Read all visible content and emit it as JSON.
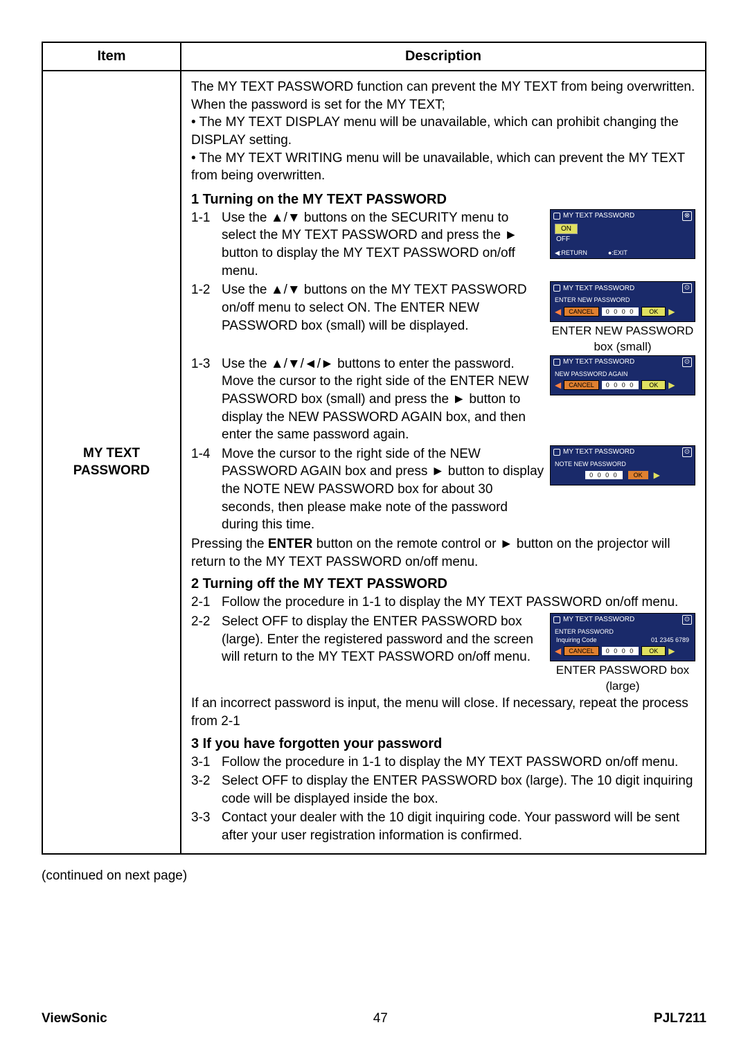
{
  "table": {
    "header_item": "Item",
    "header_desc": "Description",
    "item_name_line1": "MY TEXT",
    "item_name_line2": "PASSWORD"
  },
  "intro": {
    "p1": "The MY TEXT PASSWORD function can prevent the MY TEXT from being overwritten. When the password is set for the MY TEXT;",
    "b1": "• The MY TEXT DISPLAY menu will be unavailable, which can prohibit changing the DISPLAY setting.",
    "b2": "• The MY TEXT WRITING menu will be unavailable, which can prevent the MY TEXT from being overwritten."
  },
  "sec1": {
    "title": "1 Turning on the MY TEXT PASSWORD",
    "s11_num": "1-1",
    "s11_txt": "Use the ▲/▼ buttons on the SECURITY menu to select the MY TEXT PASSWORD and press the ► button to display the MY TEXT PASSWORD on/off menu.",
    "s12_num": "1-2",
    "s12_txt": "Use the ▲/▼ buttons on the MY TEXT PASSWORD on/off menu to select ON. The ENTER NEW PASSWORD box (small) will be displayed.",
    "s13_num": "1-3",
    "s13_txt": "Use the ▲/▼/◄/► buttons to enter the password. Move the cursor to the right side of the ENTER NEW PASSWORD box (small) and press the ► button to display the NEW PASSWORD AGAIN box, and then enter the same password again.",
    "s14_num": "1-4",
    "s14_txt": "Move the cursor to the right side of the NEW PASSWORD AGAIN box and press ► button to display the NOTE NEW PASSWORD box for about 30 seconds, then please make note of the password during this time.",
    "closing": "Pressing the ENTER button on the remote control or ► button on the projector will return to the MY TEXT PASSWORD on/off menu.",
    "closing_bold": "ENTER"
  },
  "sec2": {
    "title": "2 Turning off the MY TEXT PASSWORD",
    "s21_num": "2-1",
    "s21_txt": "Follow the procedure in 1-1 to display the MY TEXT PASSWORD on/off menu.",
    "s22_num": "2-2",
    "s22_txt": "Select OFF to display the ENTER PASSWORD box (large). Enter the registered password and the screen will return to the MY TEXT PASSWORD on/off menu.",
    "closing": "If an incorrect password is input, the menu will close. If necessary, repeat the process from 2-1"
  },
  "sec3": {
    "title": "3 If you have forgotten your password",
    "s31_num": "3-1",
    "s31_txt": "Follow the procedure in 1-1 to display the MY TEXT PASSWORD on/off menu.",
    "s32_num": "3-2",
    "s32_txt": "Select OFF to display the ENTER PASSWORD box (large). The 10 digit inquiring code will be displayed inside the box.",
    "s33_num": "3-3",
    "s33_txt": "Contact your dealer with the 10 digit inquiring code. Your password will be sent after your user registration information is confirmed."
  },
  "dialogs": {
    "title": "MY TEXT PASSWORD",
    "on": "ON",
    "off": "OFF",
    "return": "◀:RETURN",
    "exit": "●:EXIT",
    "enter_new": "ENTER NEW PASSWORD",
    "new_again": "NEW PASSWORD AGAIN",
    "note_new": "NOTE NEW PASSWORD",
    "enter_pw": "ENTER PASSWORD",
    "cancel": "CANCEL",
    "ok": "OK",
    "digits": "0 0 0 0",
    "inquiry_label": "Inquiring Code",
    "inquiry_code": "01 2345 6789",
    "caption1": "ENTER NEW PASSWORD box (small)",
    "caption2": "ENTER PASSWORD box (large)"
  },
  "continued": "(continued on next page)",
  "footer": {
    "left": "ViewSonic",
    "center": "47",
    "right": "PJL7211"
  }
}
